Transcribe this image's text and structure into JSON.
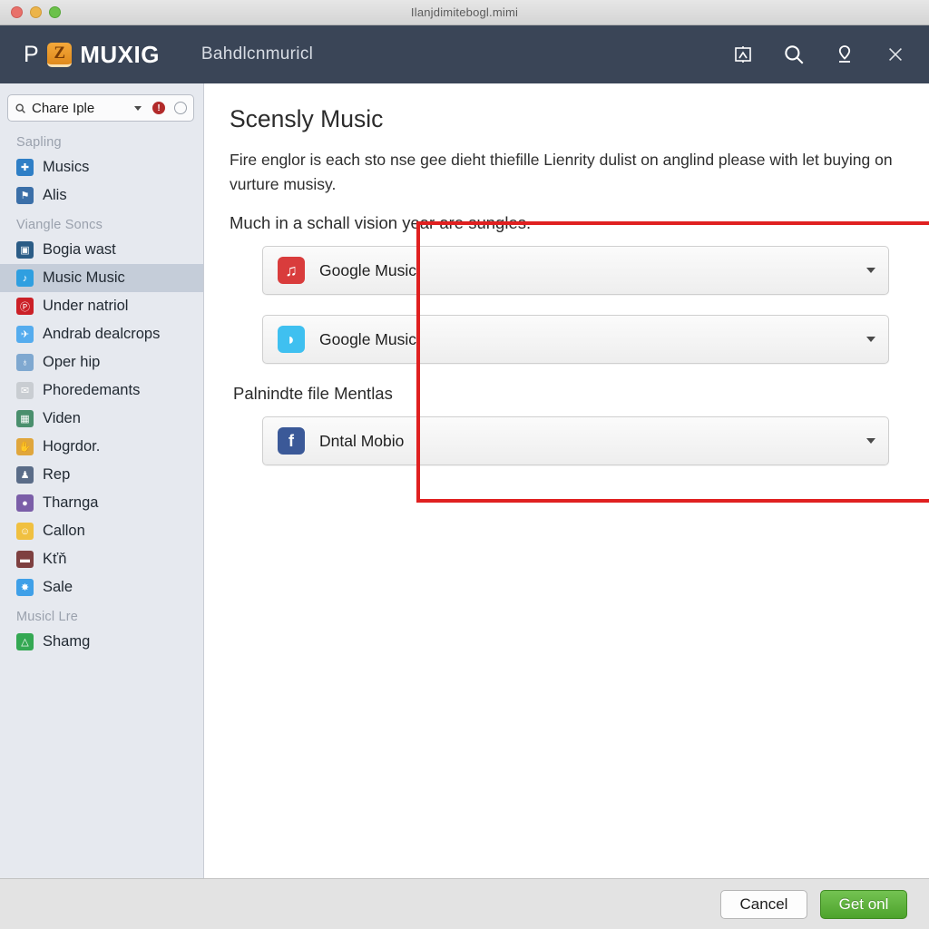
{
  "window": {
    "title": "Ilanjdimitebogl.mimi",
    "traffic_lights": [
      "close-red",
      "minimize-yellow",
      "zoom-green"
    ]
  },
  "header": {
    "brand_prefix": "P",
    "brand_badge": "Z",
    "brand_word": "MUXIG",
    "subtitle": "Bahdlcnmuricl",
    "actions": [
      {
        "name": "presentation-icon",
        "label": ""
      },
      {
        "name": "search-icon",
        "label": ""
      },
      {
        "name": "pin-icon",
        "label": ""
      },
      {
        "name": "close-icon",
        "label": ""
      }
    ]
  },
  "sidebar": {
    "search": {
      "value": "Chare Iple",
      "badge": "!"
    },
    "groups": [
      {
        "label": "Sapling",
        "items": [
          {
            "label": "Musics",
            "icon": "puzzle-icon",
            "color": "#2f7fc6",
            "glyph": "✚",
            "selected": false
          },
          {
            "label": "Alis",
            "icon": "share-icon",
            "color": "#3b6fa8",
            "glyph": "⚑",
            "selected": false
          }
        ]
      },
      {
        "label": "Viangle Soncs",
        "items": [
          {
            "label": "Bogia wast",
            "icon": "window-icon",
            "color": "#2b5c86",
            "glyph": "▣",
            "selected": false
          },
          {
            "label": "Music Music",
            "icon": "bird-blue-icon",
            "color": "#2f9fe0",
            "glyph": "♪",
            "selected": true
          },
          {
            "label": "Under natriol",
            "icon": "pinterest-icon",
            "color": "#cb2027",
            "glyph": "Ⓟ",
            "selected": false
          },
          {
            "label": "Andrab dealcrops",
            "icon": "twitter-icon",
            "color": "#55acee",
            "glyph": "✈",
            "selected": false
          },
          {
            "label": "Oper hip",
            "icon": "globe-icon",
            "color": "#7fa8d0",
            "glyph": "♁",
            "selected": false
          },
          {
            "label": "Phoredemants",
            "icon": "mail-icon",
            "color": "#c9cdd2",
            "glyph": "✉",
            "selected": false
          },
          {
            "label": "Viden",
            "icon": "photo-icon",
            "color": "#4a8f6d",
            "glyph": "▦",
            "selected": false
          },
          {
            "label": "Hogrdor.",
            "icon": "hand-icon",
            "color": "#e0a63c",
            "glyph": "✋",
            "selected": false
          },
          {
            "label": "Rep",
            "icon": "person-icon",
            "color": "#5a6c88",
            "glyph": "♟",
            "selected": false
          },
          {
            "label": "Tharnga",
            "icon": "sphere-icon",
            "color": "#7b5ea8",
            "glyph": "●",
            "selected": false
          },
          {
            "label": "Callon",
            "icon": "emoji-icon",
            "color": "#f0c040",
            "glyph": "☺",
            "selected": false
          },
          {
            "label": "Kťň",
            "icon": "card-icon",
            "color": "#7e4040",
            "glyph": "▬",
            "selected": false
          },
          {
            "label": "Sale",
            "icon": "sparkle-icon",
            "color": "#3fa0e8",
            "glyph": "✸",
            "selected": false
          }
        ]
      },
      {
        "label": "Musicl Lre",
        "items": [
          {
            "label": "Shamg",
            "icon": "drive-icon",
            "color": "#34a853",
            "glyph": "△",
            "selected": false
          }
        ]
      }
    ]
  },
  "main": {
    "page_title": "Scensly Music",
    "paragraph": "Fire englor is each sto nse gee dieht thiefille Lienrity dulist on anglind please with let buying on vurture musisy.",
    "subheading": "Much in a schall vision year are sungles.",
    "rows": [
      {
        "label": "Google Music",
        "icon": "music-note-icon",
        "color": "#d93c3c"
      },
      {
        "label": "Google Music",
        "icon": "bird-icon",
        "color": "#3fc0f0"
      }
    ],
    "section_heading": "Palnindte file Mentlas",
    "section_rows": [
      {
        "label": "Dntal Mobio",
        "icon": "facebook-icon",
        "color": "#3b5998"
      }
    ],
    "highlight_color": "#e02020"
  },
  "footer": {
    "cancel_label": "Cancel",
    "primary_label": "Get onl",
    "primary_color": "#4da32c"
  }
}
